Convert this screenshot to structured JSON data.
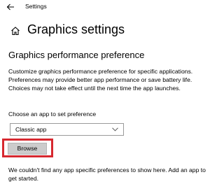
{
  "window": {
    "app_title": "Settings"
  },
  "header": {
    "title": "Graphics settings"
  },
  "section": {
    "title": "Graphics performance preference",
    "description": "Customize graphics performance preference for specific applications. Preferences may provide better app performance or save battery life. Choices may not take effect until the next time the app launches."
  },
  "app_picker": {
    "label": "Choose an app to set preference",
    "selected": "Classic app"
  },
  "browse": {
    "label": "Browse"
  },
  "empty_state": {
    "message": "We couldn't find any app specific preferences to show here. Add an app to get started."
  },
  "colors": {
    "highlight": "#d7282f",
    "button": "#cccccc"
  },
  "icons": {
    "back": "back-arrow-icon",
    "home": "home-icon",
    "dropdown": "chevron-down-icon"
  }
}
